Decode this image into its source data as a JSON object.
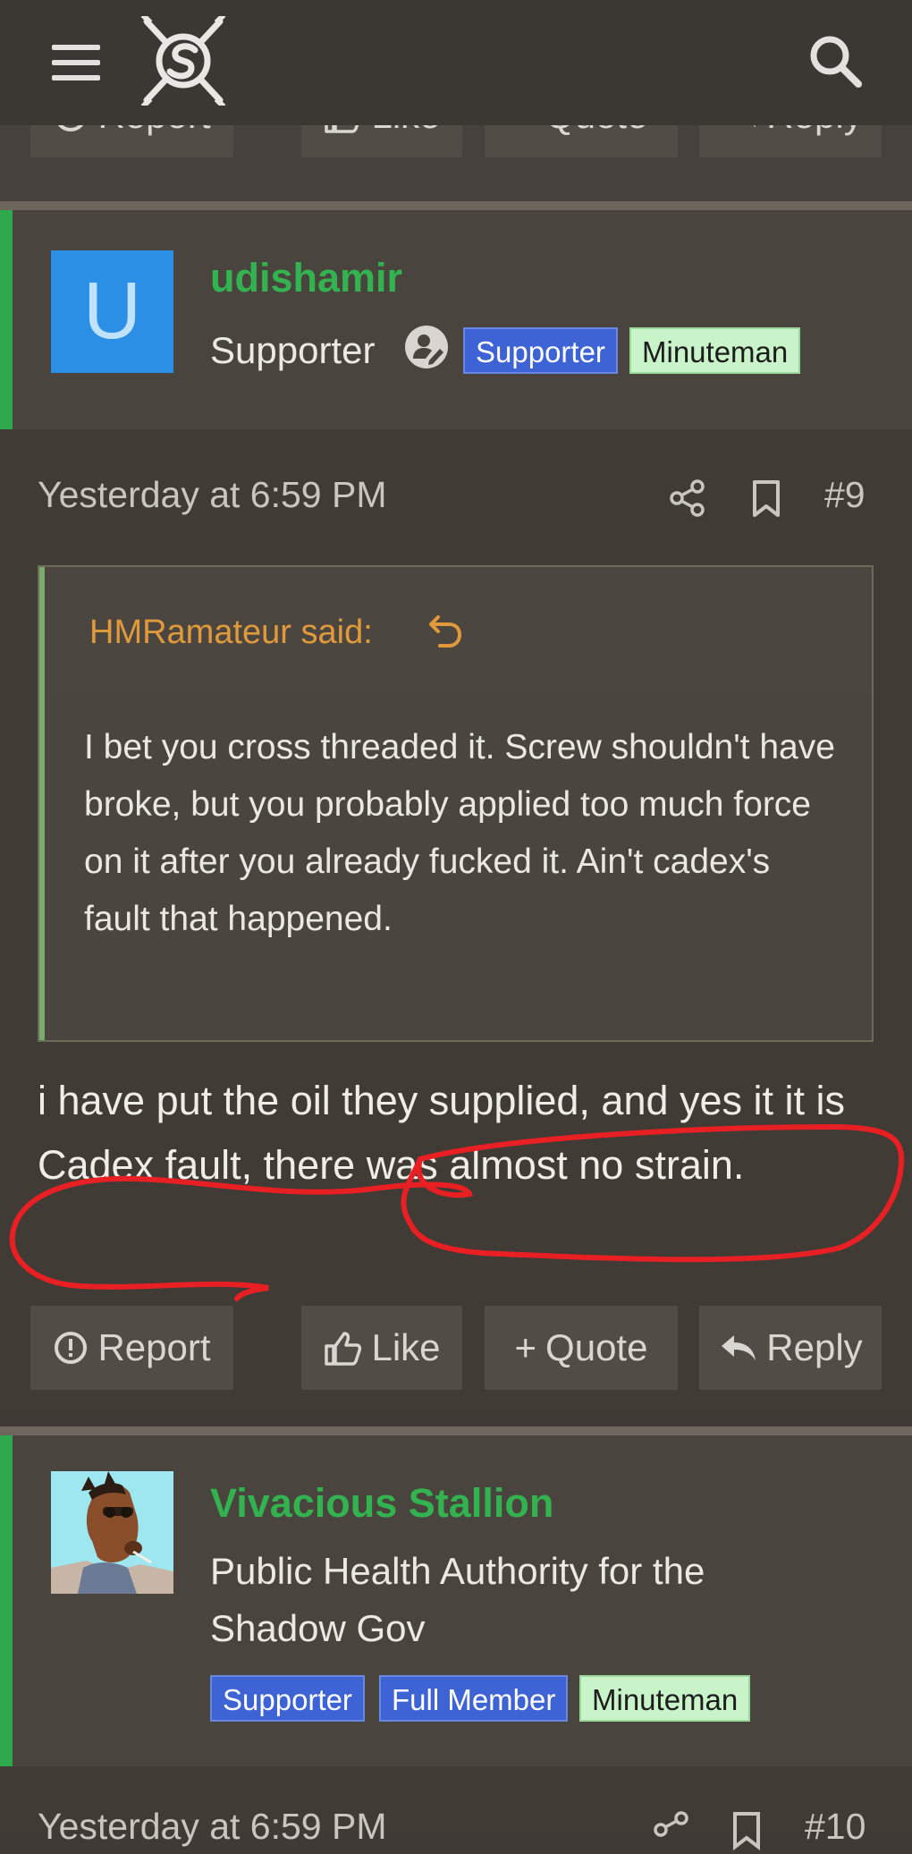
{
  "prev_post": {
    "actions": [
      "Report",
      "Like",
      "Quote",
      "Reply"
    ]
  },
  "post9": {
    "user": {
      "avatar_letter": "U",
      "name": "udishamir",
      "title": "Supporter",
      "badges": [
        "Supporter",
        "Minuteman"
      ]
    },
    "timestamp": "Yesterday at 6:59 PM",
    "post_number": "#9",
    "quote": {
      "author": "HMRamateur said:",
      "text": "I bet you cross threaded it. Screw shouldn't have broke, but you probably applied too much force on it after you already fucked it. Ain't cadex's fault that happened."
    },
    "message": "i have put the oil they supplied, and yes it it is Cadex fault, there was almost no strain.",
    "actions": [
      "Report",
      "Like",
      "Quote",
      "Reply"
    ]
  },
  "post10": {
    "user": {
      "name": "Vivacious Stallion",
      "title": "Public Health Authority for the Shadow Gov",
      "badges": [
        "Supporter",
        "Full Member",
        "Minuteman"
      ]
    },
    "timestamp": "Yesterday at 6:59 PM",
    "post_number": "#10"
  },
  "colors": {
    "username": "#33b34f",
    "quote_author": "#e09a3b",
    "annotation": "#e81f23"
  },
  "icons": [
    "menu-icon",
    "site-logo",
    "search-icon",
    "report-icon",
    "like-icon",
    "quote-plus-icon",
    "reply-icon",
    "share-icon",
    "bookmark-icon",
    "edit-user-icon",
    "jump-to-quote-icon"
  ]
}
